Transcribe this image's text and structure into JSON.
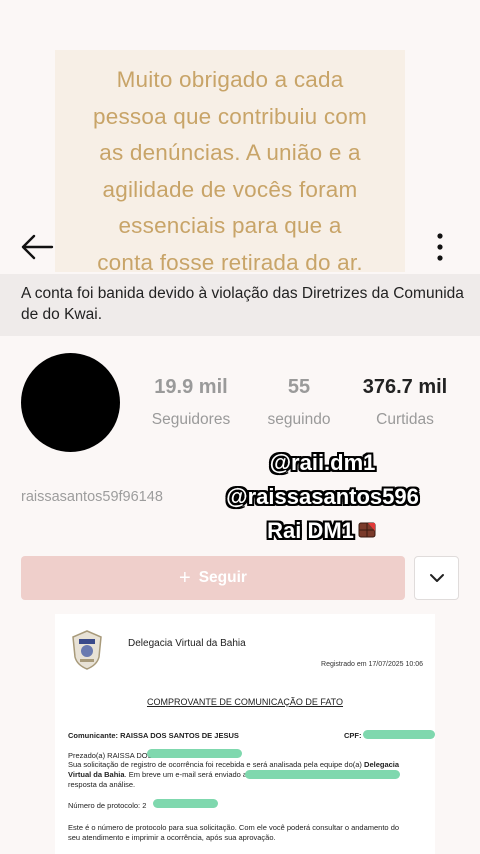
{
  "story": {
    "lines": [
      "Muito obrigado a cada",
      "pessoa que contribuiu com",
      "as denúncias. A união e a",
      "agilidade de vocês foram",
      "essenciais para que a",
      "conta fosse retirada do ar."
    ]
  },
  "header": {
    "back_icon": "arrow-left-icon",
    "more_icon": "more-vertical-icon"
  },
  "ban_notice": "A conta foi banida devido à violação das Diretrizes da Comunidade do Kwai.",
  "profile": {
    "followers_value": "19.9 mil",
    "followers_label": "Seguidores",
    "following_value": "55",
    "following_label": "seguindo",
    "likes_value": "376.7 mil",
    "likes_label": "Curtidas",
    "username": "raissasantos59f96148"
  },
  "overlay_handles": [
    "@raii.dm1",
    "@raissasantos596",
    "Rai DM1"
  ],
  "actions": {
    "follow_label": "Seguir",
    "follow_icon": "+",
    "dropdown_icon": "chevron-down-icon"
  },
  "colors": {
    "story_text": "#c8a468",
    "follow_bg": "#efcfcb",
    "highlight": "#7fd8ae"
  },
  "document": {
    "org": "Delegacia Virtual da Bahia",
    "registered": "Registrado em 17/07/2025 10:06",
    "title": "COMPROVANTE DE COMUNICAÇÃO DE FATO",
    "comunicante": "Comunicante: RAISSA DOS SANTOS DE JESUS",
    "cpf": "CPF:",
    "greeting": "Prezado(a) RAISSA DOS",
    "body1": "Sua solicitação de registro de ocorrência foi recebida e será analisada pela equipe do(a)",
    "body1_bold": "Delegacia",
    "body2_bold": "Virtual da Bahia",
    "body2": ". Em breve um e-mail será enviado a",
    "body3": "resposta da análise.",
    "protocol": "Número de protocolo: 2",
    "note1": "Este é o número de protocolo para sua solicitação. Com ele você poderá consultar o andamento do",
    "note2": "seu atendimento e imprimir a ocorrência, após sua aprovação."
  }
}
